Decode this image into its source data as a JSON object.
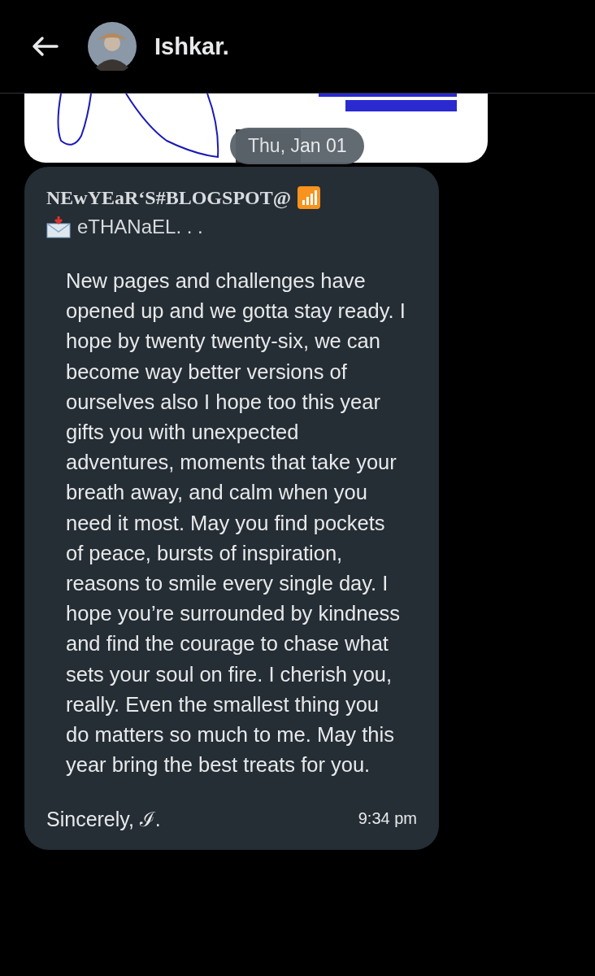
{
  "header": {
    "contact_name": "Ishkar."
  },
  "date_divider": "Thu, Jan 01",
  "message": {
    "title_line": "NEwYEaR‘S#BLOGSPOT@",
    "subtitle_line": "eTHANaEL. . .",
    "body": "New pages and challenges have opened up and we gotta stay ready. I hope by twenty twenty-six, we can become way better versions of ourselves also I hope too this year gifts you with unexpected adventures, moments that take your breath away, and calm when you need it most. May you find pockets of peace, bursts of inspiration, reasons to smile every single day. I hope you’re surrounded by kindness and find the courage to chase what sets your soul on fire. I cherish you, really. Even the smallest thing you do matters so much to me. May this year bring the best treats for you.",
    "signature": "Sincerely, ℐ.",
    "time": "9:34 pm"
  }
}
